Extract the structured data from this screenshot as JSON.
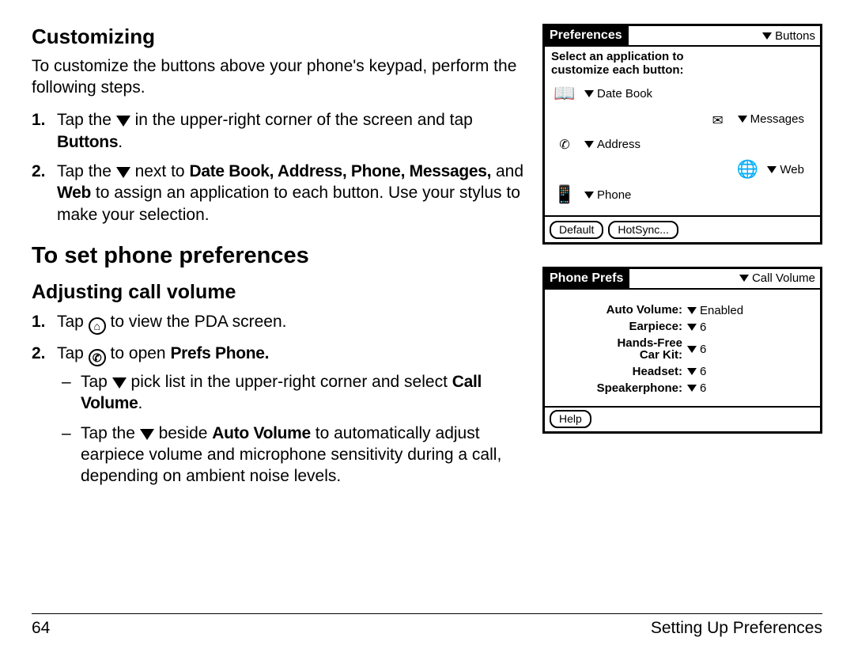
{
  "headings": {
    "customizing": "Customizing",
    "set_phone_prefs": "To set phone preferences",
    "adjusting_call_volume": "Adjusting call volume"
  },
  "intro": "To customize the buttons above your phone's keypad, perform the following steps.",
  "steps_customizing": [
    {
      "num": "1.",
      "pre": "Tap the ",
      "post1": " in the upper-right corner of the screen and tap ",
      "bold1": "Buttons",
      "post2": "."
    },
    {
      "num": "2.",
      "pre": "Tap the ",
      "post1": " next to ",
      "bold1": "Date Book, Address, Phone, Messages,",
      "mid1": " and ",
      "bold2": "Web",
      "post2": " to assign an application to each button. Use your stylus to make your selection."
    }
  ],
  "steps_volume": [
    {
      "num": "1.",
      "pre": "Tap ",
      "post": " to view the PDA screen."
    },
    {
      "num": "2.",
      "pre": "Tap ",
      "post": " to open ",
      "bold": "Prefs Phone."
    }
  ],
  "sub_volume": [
    {
      "pre": "Tap ",
      "post": " pick list in the upper-right corner and select ",
      "bold": "Call Volume",
      "tail": "."
    },
    {
      "pre": "Tap the ",
      "post": " beside ",
      "bold": "Auto Volume",
      "tail": " to automatically adjust earpiece volume and microphone sensitivity during a call, depending on ambient noise levels."
    }
  ],
  "palm_prefs": {
    "title": "Preferences",
    "drop": "Buttons",
    "instr1": "Select an application to",
    "instr2": "customize each button:",
    "rows": [
      {
        "side": "left",
        "label": "Date Book"
      },
      {
        "side": "right",
        "label": "Messages"
      },
      {
        "side": "left",
        "label": "Address"
      },
      {
        "side": "right",
        "label": "Web"
      },
      {
        "side": "left",
        "label": "Phone"
      }
    ],
    "footer_btns": [
      "Default",
      "HotSync..."
    ]
  },
  "palm_phone": {
    "title": "Phone Prefs",
    "drop": "Call Volume",
    "rows": [
      {
        "k": "Auto Volume:",
        "v": "Enabled"
      },
      {
        "k": "Earpiece:",
        "v": "6"
      },
      {
        "k": "Hands-Free\nCar Kit:",
        "v": "6"
      },
      {
        "k": "Headset:",
        "v": "6"
      },
      {
        "k": "Speakerphone:",
        "v": "6"
      }
    ],
    "help": "Help"
  },
  "footer": {
    "page": "64",
    "section": "Setting Up Preferences"
  }
}
